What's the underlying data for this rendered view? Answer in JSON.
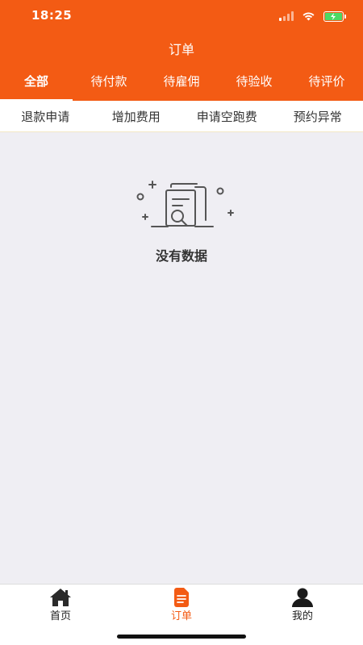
{
  "status_bar": {
    "time": "18:25"
  },
  "nav": {
    "title": "订单"
  },
  "tabs": [
    {
      "label": "全部",
      "active": true
    },
    {
      "label": "待付款",
      "active": false
    },
    {
      "label": "待雇佣",
      "active": false
    },
    {
      "label": "待验收",
      "active": false
    },
    {
      "label": "待评价",
      "active": false
    }
  ],
  "subtabs": [
    {
      "label": "退款申请"
    },
    {
      "label": "增加费用"
    },
    {
      "label": "申请空跑费"
    },
    {
      "label": "预约异常"
    }
  ],
  "empty_state": {
    "text": "没有数据",
    "icon": "no-data-icon"
  },
  "tabbar": [
    {
      "label": "首页",
      "icon": "home-icon",
      "active": false
    },
    {
      "label": "订单",
      "icon": "order-document-icon",
      "active": true
    },
    {
      "label": "我的",
      "icon": "user-icon",
      "active": false
    }
  ],
  "colors": {
    "accent": "#f35b14",
    "background": "#efeef3"
  }
}
